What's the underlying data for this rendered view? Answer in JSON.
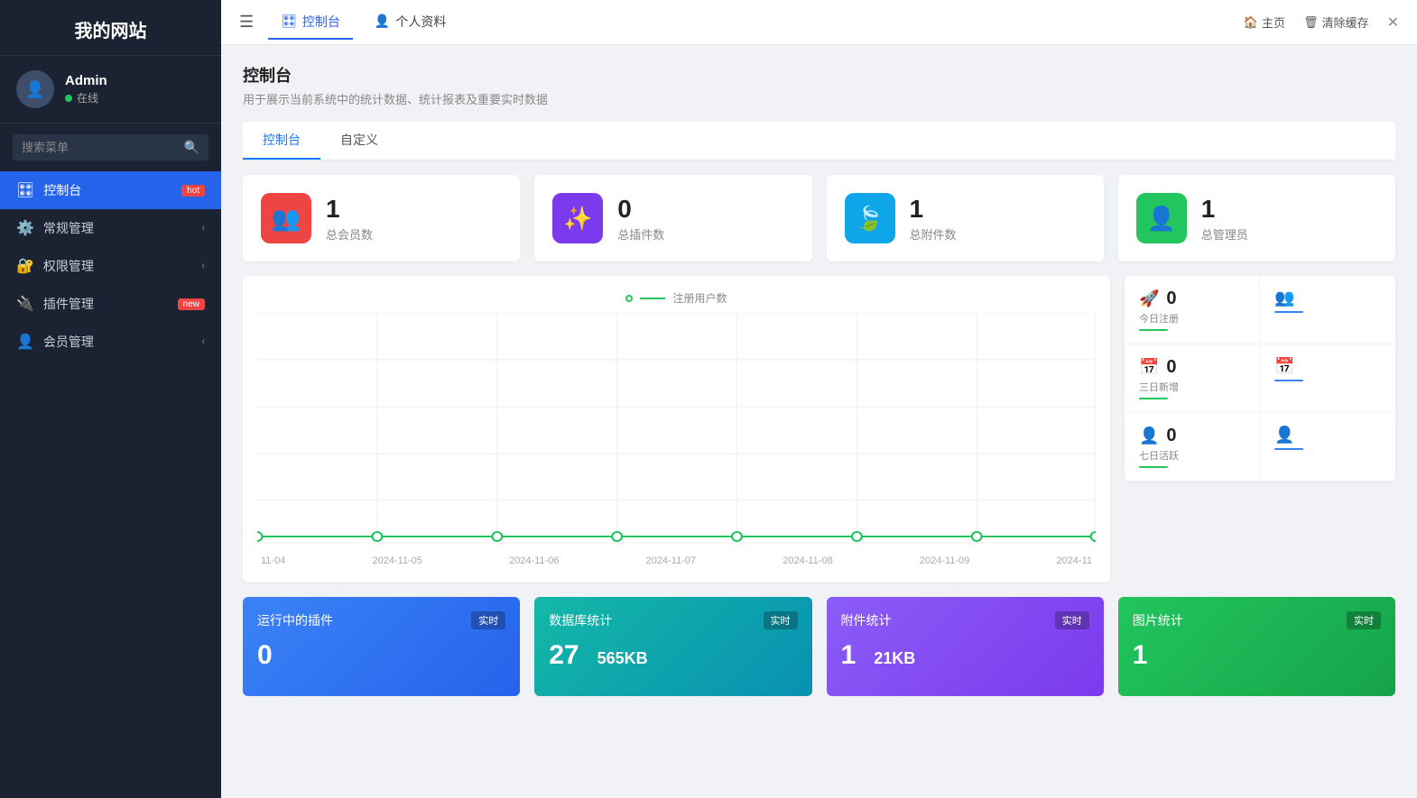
{
  "sidebar": {
    "site_title": "我的网站",
    "user": {
      "name": "Admin",
      "status": "在线"
    },
    "search_placeholder": "搜索菜单",
    "nav_items": [
      {
        "id": "dashboard",
        "label": "控制台",
        "icon": "🎛",
        "badge": "hot",
        "active": true
      },
      {
        "id": "general",
        "label": "常规管理",
        "icon": "⚙",
        "arrow": true
      },
      {
        "id": "permission",
        "label": "权限管理",
        "icon": "🔒",
        "arrow": true
      },
      {
        "id": "plugin",
        "label": "插件管理",
        "icon": "🔌",
        "badge": "new"
      },
      {
        "id": "member",
        "label": "会员管理",
        "icon": "👤",
        "arrow": true
      }
    ]
  },
  "topbar": {
    "menu_icon": "☰",
    "tabs": [
      {
        "label": "控制台",
        "icon": "🎛",
        "active": true
      },
      {
        "label": "个人资料",
        "icon": "👤",
        "active": false
      }
    ],
    "right_links": [
      {
        "label": "主页",
        "icon": "🏠"
      },
      {
        "label": "清除缓存",
        "icon": "🗑"
      }
    ],
    "close_label": "✕"
  },
  "page": {
    "title": "控制台",
    "desc": "用于展示当前系统中的统计数据、统计报表及重要实时数据"
  },
  "sub_tabs": [
    {
      "label": "控制台",
      "active": true
    },
    {
      "label": "自定义",
      "active": false
    }
  ],
  "stats_cards": [
    {
      "num": "1",
      "label": "总会员数",
      "icon_color": "red",
      "icon": "👥"
    },
    {
      "num": "0",
      "label": "总插件数",
      "icon_color": "purple",
      "icon": "✨"
    },
    {
      "num": "1",
      "label": "总附件数",
      "icon_color": "teal",
      "icon": "🍃"
    },
    {
      "num": "1",
      "label": "总管理员",
      "icon_color": "green",
      "icon": "👤"
    }
  ],
  "chart": {
    "legend_label": "注册用户数",
    "dates": [
      "11-04",
      "2024-11-05",
      "2024-11-06",
      "2024-11-07",
      "2024-11-08",
      "2024-11-09",
      "2024-11"
    ]
  },
  "right_stats": [
    {
      "icon": "🚀",
      "val": "0",
      "label": "今日注册",
      "icon_color": "#22c55e"
    },
    {
      "icon": "👥",
      "val": "",
      "label": "",
      "icon_color": "#3b82f6"
    },
    {
      "icon": "📅",
      "val": "0",
      "label": "三日新增",
      "icon_color": "#22c55e"
    },
    {
      "icon": "📅",
      "val": "",
      "label": "",
      "icon_color": "#3b82f6"
    },
    {
      "icon": "👤",
      "val": "0",
      "label": "七日活跃",
      "icon_color": "#22c55e"
    },
    {
      "icon": "👤",
      "val": "",
      "label": "",
      "icon_color": "#3b82f6"
    }
  ],
  "bottom_cards": [
    {
      "title": "运行中的插件",
      "badge": "实时",
      "big": "0",
      "sub": "",
      "style": "blue"
    },
    {
      "title": "数据库统计",
      "badge": "实时",
      "big": "27",
      "sub": "565KB",
      "style": "teal"
    },
    {
      "title": "附件统计",
      "badge": "实时",
      "big": "1",
      "sub": "21KB",
      "style": "violet"
    },
    {
      "title": "图片统计",
      "badge": "实时",
      "big": "1",
      "sub": "",
      "style": "green"
    }
  ]
}
